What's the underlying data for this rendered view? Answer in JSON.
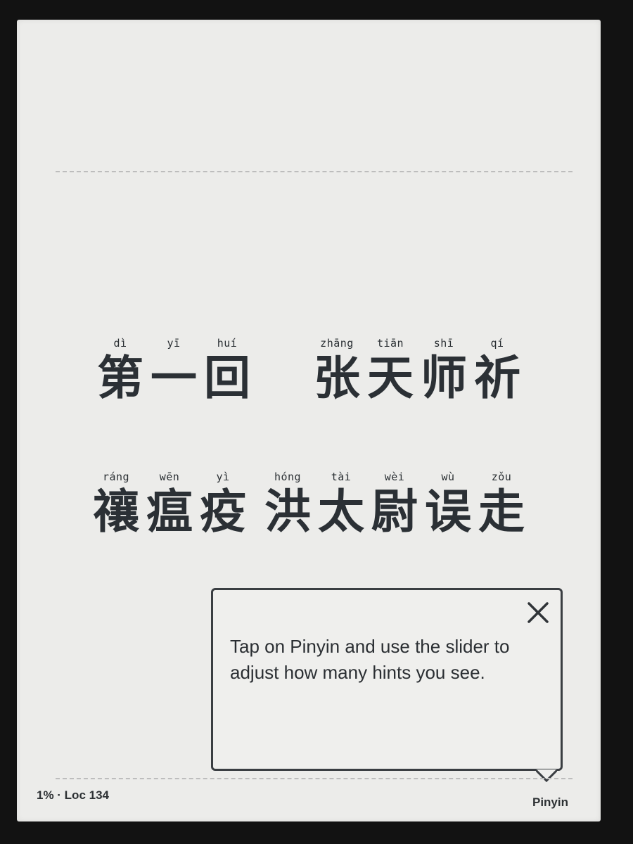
{
  "chapter": {
    "line1": [
      {
        "pinyin": "dì",
        "char": "第"
      },
      {
        "pinyin": "yī",
        "char": "一"
      },
      {
        "pinyin": "huí",
        "char": "回"
      },
      {
        "pinyin": "zhāng",
        "char": "张"
      },
      {
        "pinyin": "tiān",
        "char": "天"
      },
      {
        "pinyin": "shī",
        "char": "师"
      },
      {
        "pinyin": "qí",
        "char": "祈"
      }
    ],
    "line2": [
      {
        "pinyin": "ráng",
        "char": "禳"
      },
      {
        "pinyin": "wēn",
        "char": "瘟"
      },
      {
        "pinyin": "yì",
        "char": "疫"
      },
      {
        "pinyin": "hóng",
        "char": "洪"
      },
      {
        "pinyin": "tài",
        "char": "太"
      },
      {
        "pinyin": "wèi",
        "char": "尉"
      },
      {
        "pinyin": "wù",
        "char": "误"
      },
      {
        "pinyin": "zǒu",
        "char": "走"
      }
    ]
  },
  "tooltip": {
    "message": "Tap on Pinyin and use the slider to adjust how many hints you see.",
    "close_icon": "close-icon"
  },
  "footer": {
    "progress": "1% · Loc 134",
    "pinyin_label": "Pinyin"
  }
}
